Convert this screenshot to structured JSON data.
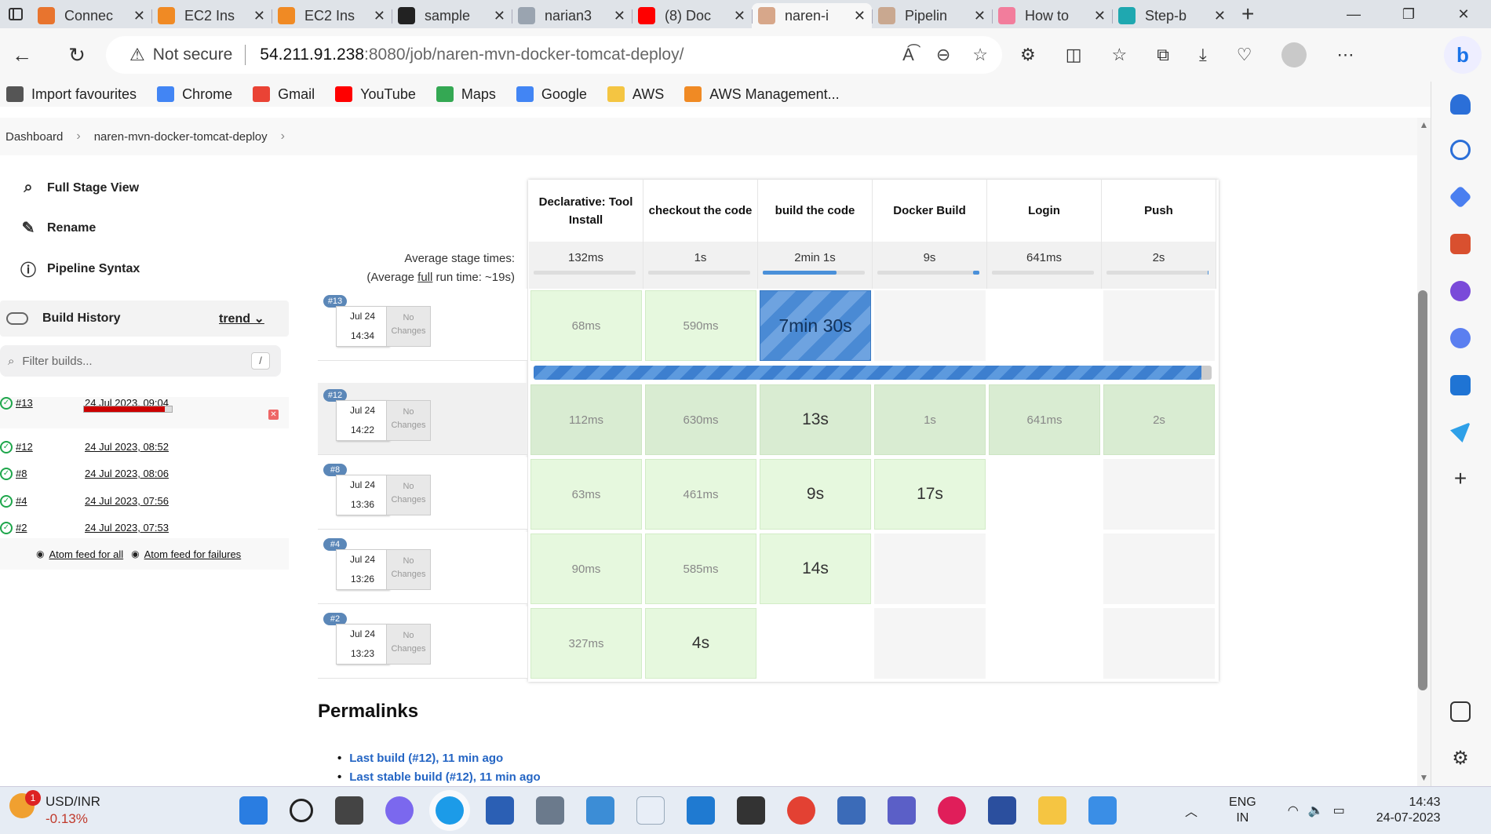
{
  "browser": {
    "tabs": [
      {
        "label": "Connec",
        "icon_color": "#e8742e",
        "active": false
      },
      {
        "label": "EC2 Ins",
        "icon_color": "#f08a24",
        "active": false
      },
      {
        "label": "EC2 Ins",
        "icon_color": "#f08a24",
        "active": false
      },
      {
        "label": "sample",
        "icon_color": "#222222",
        "active": false
      },
      {
        "label": "narian3",
        "icon_color": "#9aa4b0",
        "active": false
      },
      {
        "label": "(8) Doc",
        "icon_color": "#ff0000",
        "active": false
      },
      {
        "label": "naren-i",
        "icon_color": "#d7a78a",
        "active": true
      },
      {
        "label": "Pipelin",
        "icon_color": "#c9a890",
        "active": false
      },
      {
        "label": "How to",
        "icon_color": "#f27d9c",
        "active": false
      },
      {
        "label": "Step-b",
        "icon_color": "#1fa8b0",
        "active": false
      }
    ],
    "address": {
      "security": "Not secure",
      "host": "54.211.91.238",
      "rest": ":8080/job/naren-mvn-docker-tomcat-deploy/"
    },
    "favourites": [
      {
        "label": "Import favourites",
        "color": "#555555"
      },
      {
        "label": "Chrome",
        "color": "#4285f4"
      },
      {
        "label": "Gmail",
        "color": "#ea4335"
      },
      {
        "label": "YouTube",
        "color": "#ff0000"
      },
      {
        "label": "Maps",
        "color": "#34a853"
      },
      {
        "label": "Google",
        "color": "#4285f4"
      },
      {
        "label": "AWS",
        "color": "#f4c542"
      },
      {
        "label": "AWS Management...",
        "color": "#f08a24"
      }
    ]
  },
  "breadcrumb": {
    "home": "Dashboard",
    "job": "naren-mvn-docker-tomcat-deploy"
  },
  "tasks": {
    "full_stage_view": "Full Stage View",
    "rename": "Rename",
    "pipeline_syntax": "Pipeline Syntax"
  },
  "build_history": {
    "title": "Build History",
    "trend": "trend",
    "filter_placeholder": "Filter builds...",
    "filter_shortcut": "/",
    "builds": [
      {
        "num": "#13",
        "date": "24 Jul 2023, 09:04",
        "running": true,
        "progress": 0.92
      },
      {
        "num": "#12",
        "date": "24 Jul 2023, 08:52"
      },
      {
        "num": "#8",
        "date": "24 Jul 2023, 08:06"
      },
      {
        "num": "#4",
        "date": "24 Jul 2023, 07:56"
      },
      {
        "num": "#2",
        "date": "24 Jul 2023, 07:53"
      }
    ],
    "atom_all": "Atom feed for all",
    "atom_failures": "Atom feed for failures"
  },
  "stage_view": {
    "avg_label_1": "Average stage times:",
    "avg_label_2a": "(Average ",
    "avg_label_2b": "full",
    "avg_label_2c": " run time: ~19s)",
    "stages": [
      {
        "name": "Declarative: Tool Install",
        "avg": "132ms",
        "avg_fill": 0.0
      },
      {
        "name": "checkout the code",
        "avg": "1s",
        "avg_fill": 0.0
      },
      {
        "name": "build the code",
        "avg": "2min 1s",
        "avg_fill": 0.72
      },
      {
        "name": "Docker Build",
        "avg": "9s",
        "avg_fill": 0.06
      },
      {
        "name": "Login",
        "avg": "641ms",
        "avg_fill": 0.0
      },
      {
        "name": "Push",
        "avg": "2s",
        "avg_fill": 0.01
      }
    ],
    "runs": [
      {
        "badge": "#13",
        "date": "Jul 24",
        "time": "14:34",
        "changes": "No Changes",
        "cells": [
          "68ms",
          "590ms",
          "7min 30s",
          "",
          "",
          ""
        ],
        "running_progress": 0.985
      },
      {
        "badge": "#12",
        "date": "Jul 24",
        "time": "14:22",
        "changes": "No Changes",
        "cells": [
          "112ms",
          "630ms",
          "13s",
          "1s",
          "641ms",
          "2s"
        ]
      },
      {
        "badge": "#8",
        "date": "Jul 24",
        "time": "13:36",
        "changes": "No Changes",
        "cells": [
          "63ms",
          "461ms",
          "9s",
          "17s",
          "",
          ""
        ]
      },
      {
        "badge": "#4",
        "date": "Jul 24",
        "time": "13:26",
        "changes": "No Changes",
        "cells": [
          "90ms",
          "585ms",
          "14s",
          "",
          "",
          ""
        ]
      },
      {
        "badge": "#2",
        "date": "Jul 24",
        "time": "13:23",
        "changes": "No Changes",
        "cells": [
          "327ms",
          "4s",
          "",
          "",
          "",
          ""
        ]
      }
    ]
  },
  "permalinks": {
    "title": "Permalinks",
    "links": [
      "Last build (#12), 11 min ago",
      "Last stable build (#12), 11 min ago"
    ]
  },
  "taskbar": {
    "weather_title": "USD/INR",
    "weather_value": "-0.13%",
    "weather_badge": "1",
    "lang_1": "ENG",
    "lang_2": "IN",
    "time": "14:43",
    "date": "24-07-2023"
  }
}
